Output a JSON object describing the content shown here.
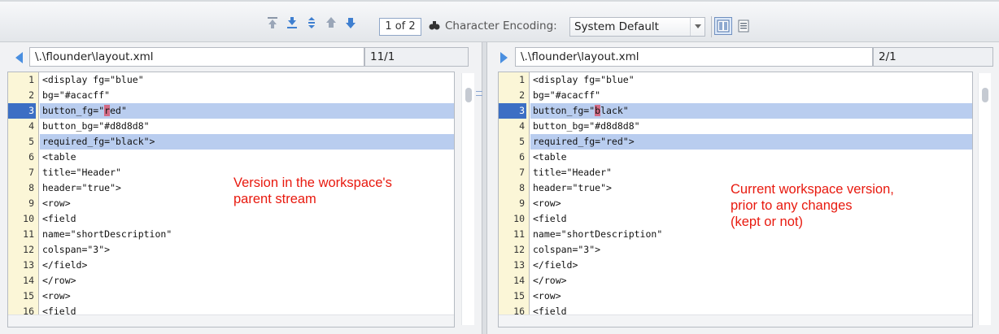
{
  "toolbar": {
    "pager": "1 of 2",
    "encoding_label": "Character Encoding:",
    "encoding_value": "System Default",
    "icons": [
      "first-diff-icon",
      "last-diff-icon",
      "change-next-icon",
      "prev-diff-icon",
      "next-diff-icon",
      "find-icon",
      "side-by-side-icon",
      "unified-view-icon"
    ]
  },
  "left": {
    "path": "\\.\\flounder\\layout.xml",
    "position": "11/1",
    "annotation_line1": "Version in the workspace's",
    "annotation_line2": "parent stream",
    "lines": [
      {
        "n": "1",
        "pre": "<display fg=\"blue\"",
        "mark": "",
        "post": ""
      },
      {
        "n": "2",
        "pre": "bg=\"#acacff\"",
        "mark": "",
        "post": ""
      },
      {
        "n": "3",
        "pre": "button_fg=\"",
        "mark": "r",
        "post": "ed\""
      },
      {
        "n": "4",
        "pre": "button_bg=\"#d8d8d8\"",
        "mark": "",
        "post": ""
      },
      {
        "n": "5",
        "pre": "required_fg=\"black\">",
        "mark": "",
        "post": ""
      },
      {
        "n": "6",
        "pre": "<table",
        "mark": "",
        "post": ""
      },
      {
        "n": "7",
        "pre": "title=\"Header\"",
        "mark": "",
        "post": ""
      },
      {
        "n": "8",
        "pre": "header=\"true\">",
        "mark": "",
        "post": ""
      },
      {
        "n": "9",
        "pre": "<row>",
        "mark": "",
        "post": ""
      },
      {
        "n": "10",
        "pre": "<field",
        "mark": "",
        "post": ""
      },
      {
        "n": "11",
        "pre": "name=\"shortDescription\"",
        "mark": "",
        "post": ""
      },
      {
        "n": "12",
        "pre": "colspan=\"3\">",
        "mark": "",
        "post": ""
      },
      {
        "n": "13",
        "pre": "</field>",
        "mark": "",
        "post": ""
      },
      {
        "n": "14",
        "pre": "</row>",
        "mark": "",
        "post": ""
      },
      {
        "n": "15",
        "pre": "<row>",
        "mark": "",
        "post": ""
      },
      {
        "n": "16",
        "pre": "<field",
        "mark": "",
        "post": ""
      }
    ]
  },
  "right": {
    "path": "\\.\\flounder\\layout.xml",
    "position": "2/1",
    "annotation_line1": "Current workspace version,",
    "annotation_line2": "prior to any changes",
    "annotation_line3": "(kept or not)",
    "lines": [
      {
        "n": "1",
        "pre": "<display fg=\"blue\"",
        "mark": "",
        "post": ""
      },
      {
        "n": "2",
        "pre": "bg=\"#acacff\"",
        "mark": "",
        "post": ""
      },
      {
        "n": "3",
        "pre": "button_fg=\"",
        "mark": "b",
        "post": "lack\""
      },
      {
        "n": "4",
        "pre": "button_bg=\"#d8d8d8\"",
        "mark": "",
        "post": ""
      },
      {
        "n": "5",
        "pre": "required_fg=\"red\">",
        "mark": "",
        "post": ""
      },
      {
        "n": "6",
        "pre": "<table",
        "mark": "",
        "post": ""
      },
      {
        "n": "7",
        "pre": "title=\"Header\"",
        "mark": "",
        "post": ""
      },
      {
        "n": "8",
        "pre": "header=\"true\">",
        "mark": "",
        "post": ""
      },
      {
        "n": "9",
        "pre": "<row>",
        "mark": "",
        "post": ""
      },
      {
        "n": "10",
        "pre": "<field",
        "mark": "",
        "post": ""
      },
      {
        "n": "11",
        "pre": "name=\"shortDescription\"",
        "mark": "",
        "post": ""
      },
      {
        "n": "12",
        "pre": "colspan=\"3\">",
        "mark": "",
        "post": ""
      },
      {
        "n": "13",
        "pre": "</field>",
        "mark": "",
        "post": ""
      },
      {
        "n": "14",
        "pre": "</row>",
        "mark": "",
        "post": ""
      },
      {
        "n": "15",
        "pre": "<row>",
        "mark": "",
        "post": ""
      },
      {
        "n": "16",
        "pre": "<field",
        "mark": "",
        "post": ""
      }
    ]
  },
  "colors": {
    "annotation": "#e8190e",
    "changed_line": "#b9cdef",
    "char_diff": "#d36b85",
    "selected_line_number": "#3c6fc4"
  }
}
